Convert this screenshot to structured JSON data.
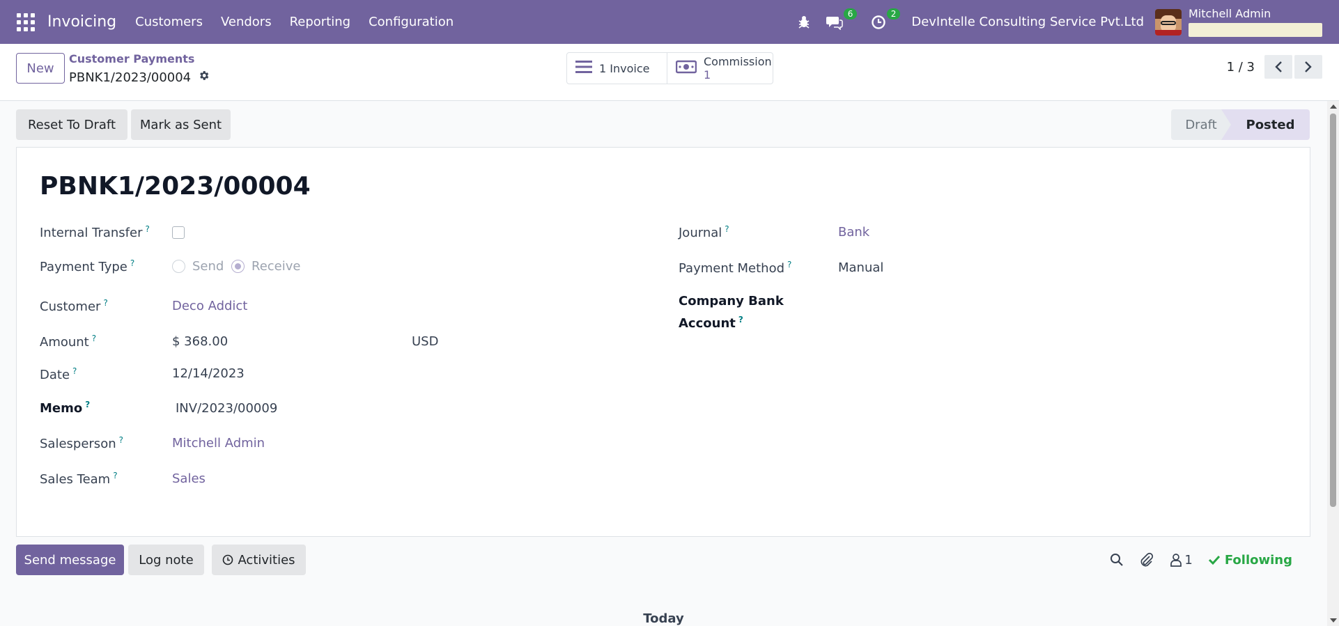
{
  "navbar": {
    "app_name": "Invoicing",
    "menu": [
      "Customers",
      "Vendors",
      "Reporting",
      "Configuration"
    ],
    "messages_count": "6",
    "activities_count": "2",
    "company": "DevIntelle Consulting Service Pvt.Ltd",
    "user_name": "Mitchell Admin",
    "color": "#71639e"
  },
  "control_panel": {
    "new_label": "New",
    "breadcrumb_parent": "Customer Payments",
    "breadcrumb_current": "PBNK1/2023/00004",
    "smart_invoice": "1 Invoice",
    "smart_commission_label": "Commission",
    "smart_commission_value": "1",
    "pager": "1 / 3"
  },
  "actions": {
    "reset_to_draft": "Reset To Draft",
    "mark_as_sent": "Mark as Sent"
  },
  "status": {
    "steps": [
      "Draft",
      "Posted"
    ],
    "current": "Posted"
  },
  "form": {
    "title": "PBNK1/2023/00004",
    "left": {
      "internal_transfer_label": "Internal Transfer",
      "payment_type_label": "Payment Type",
      "payment_type_options": [
        "Send",
        "Receive"
      ],
      "payment_type_selected": "Receive",
      "customer_label": "Customer",
      "customer_value": "Deco Addict",
      "amount_label": "Amount",
      "amount_value": "$ 368.00",
      "currency_value": "USD",
      "date_label": "Date",
      "date_value": "12/14/2023",
      "memo_label": "Memo",
      "memo_value": "INV/2023/00009",
      "salesperson_label": "Salesperson",
      "salesperson_value": "Mitchell Admin",
      "sales_team_label": "Sales Team",
      "sales_team_value": "Sales"
    },
    "right": {
      "journal_label": "Journal",
      "journal_value": "Bank",
      "payment_method_label": "Payment Method",
      "payment_method_value": "Manual",
      "company_bank_label_line1": "Company Bank",
      "company_bank_label_line2": "Account"
    },
    "help_mark": "?"
  },
  "chatter": {
    "send_message": "Send message",
    "log_note": "Log note",
    "activities": "Activities",
    "followers_count": "1",
    "following": "Following",
    "today": "Today"
  }
}
